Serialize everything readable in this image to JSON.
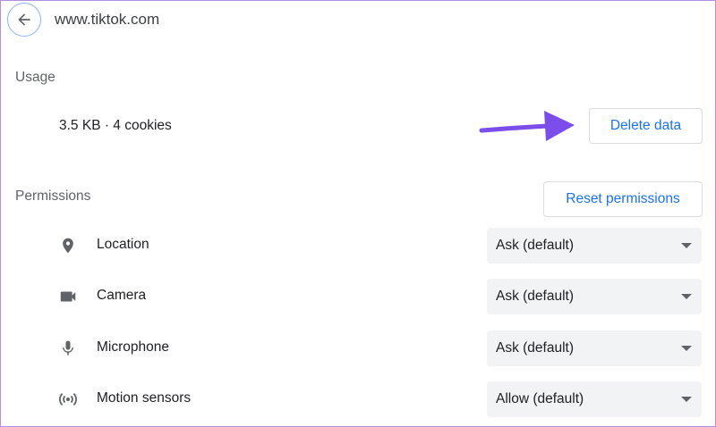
{
  "header": {
    "back_icon": "arrow-left-icon",
    "site": "www.tiktok.com"
  },
  "usage": {
    "heading": "Usage",
    "summary": "3.5 KB · 4 cookies",
    "delete_label": "Delete data",
    "annotation_arrow_color": "#7b4dea"
  },
  "permissions": {
    "heading": "Permissions",
    "reset_label": "Reset permissions",
    "items": [
      {
        "label": "Location",
        "icon": "location-pin-icon",
        "value": "Ask (default)"
      },
      {
        "label": "Camera",
        "icon": "camera-icon",
        "value": "Ask (default)"
      },
      {
        "label": "Microphone",
        "icon": "microphone-icon",
        "value": "Ask (default)"
      },
      {
        "label": "Motion sensors",
        "icon": "motion-sensors-icon",
        "value": "Allow (default)"
      }
    ]
  },
  "colors": {
    "accent": "#1a73e8",
    "frame_border": "#b48ee0"
  }
}
